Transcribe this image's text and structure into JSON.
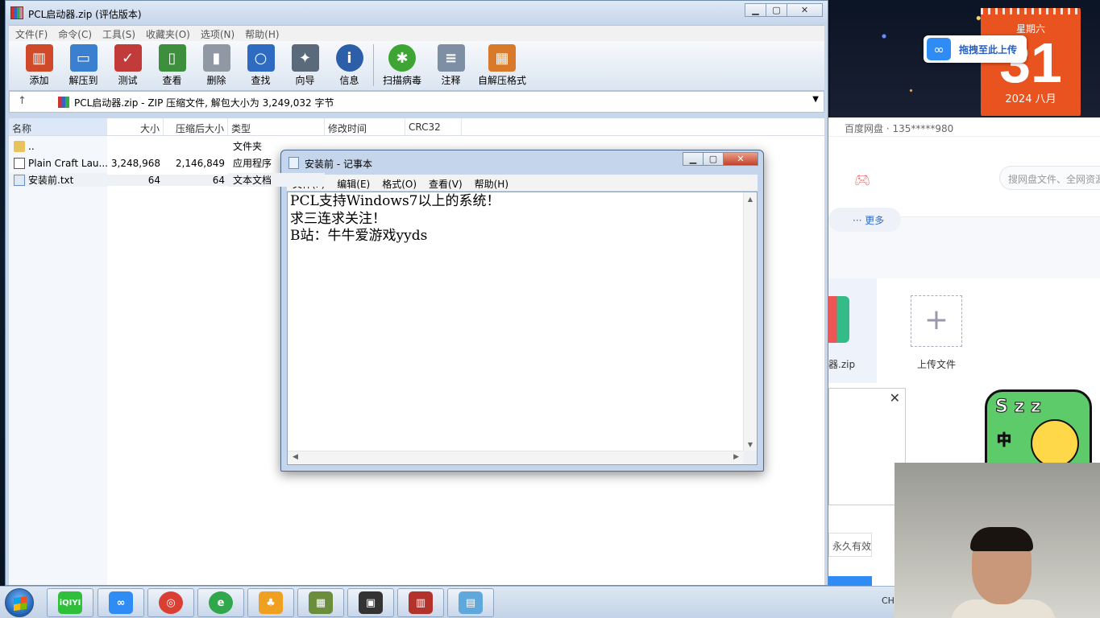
{
  "winrar": {
    "title": "PCL启动器.zip (评估版本)",
    "menu": [
      "文件(F)",
      "命令(C)",
      "工具(S)",
      "收藏夹(O)",
      "选项(N)",
      "帮助(H)"
    ],
    "toolbar": [
      {
        "label": "添加",
        "icon": "books-add-icon",
        "color": "#d04a2a"
      },
      {
        "label": "解压到",
        "icon": "folder-extract-icon",
        "color": "#3a7fd0"
      },
      {
        "label": "测试",
        "icon": "clipboard-check-icon",
        "color": "#c23b3b"
      },
      {
        "label": "查看",
        "icon": "open-book-icon",
        "color": "#3d8f3d"
      },
      {
        "label": "删除",
        "icon": "trash-icon",
        "color": "#8f98a3"
      },
      {
        "label": "查找",
        "icon": "magnifier-icon",
        "color": "#2f6bc1"
      },
      {
        "label": "向导",
        "icon": "magic-wand-icon",
        "color": "#5b6a7a"
      },
      {
        "label": "信息",
        "icon": "info-icon",
        "color": "#2d5ea8"
      },
      {
        "label": "扫描病毒",
        "icon": "virus-scan-icon",
        "color": "#3ea434"
      },
      {
        "label": "注释",
        "icon": "comment-icon",
        "color": "#7f8fa3"
      },
      {
        "label": "自解压格式",
        "icon": "sfx-box-icon",
        "color": "#d97a2a"
      }
    ],
    "path_text": "PCL启动器.zip - ZIP 压缩文件, 解包大小为 3,249,032 字节",
    "columns": [
      "名称",
      "大小",
      "压缩后大小",
      "类型",
      "修改时间",
      "CRC32"
    ],
    "files": [
      {
        "name": "..",
        "size": "",
        "packed": "",
        "type": "文件夹",
        "icon": "folder"
      },
      {
        "name": "Plain Craft Lau...",
        "size": "3,248,968",
        "packed": "2,146,849",
        "type": "应用程序",
        "icon": "app"
      },
      {
        "name": "安装前.txt",
        "size": "64",
        "packed": "64",
        "type": "文本文档",
        "icon": "txt"
      }
    ]
  },
  "notepad": {
    "title": "安装前 - 记事本",
    "menu": [
      "文件(F)",
      "编辑(E)",
      "格式(O)",
      "查看(V)",
      "帮助(H)"
    ],
    "content": "PCL支持Windows7以上的系统！\n求三连求关注！\nB站：牛牛爱游戏yyds"
  },
  "desktop": {
    "calendar": {
      "weekday": "星期六",
      "day": "31",
      "year_month": "2024 八月"
    },
    "upload_pill": "拖拽至此上传",
    "baidu": {
      "title": "百度网盘 · 135*****980",
      "search_placeholder": "搜网盘文件、全网资源",
      "more": "··· 更多",
      "file_name": "器.zip",
      "upload_label": "上传文件",
      "permanent": "永久有效"
    },
    "sticker": {
      "zz": "S z z",
      "zh": "中"
    },
    "tray_lang": "CH"
  },
  "taskbar": {
    "apps": [
      {
        "name": "iqiyi",
        "label": "iQIYI",
        "color": "#2fbf3a"
      },
      {
        "name": "baidu-netdisk",
        "label": "∞",
        "color": "#2f8cf5"
      },
      {
        "name": "chrome",
        "label": "◎",
        "color": "#d93f33"
      },
      {
        "name": "ie",
        "label": "e",
        "color": "#2fa74a"
      },
      {
        "name": "qq",
        "label": "♣",
        "color": "#f0a020"
      },
      {
        "name": "minecraft",
        "label": "▦",
        "color": "#6b8e3d"
      },
      {
        "name": "bilibili",
        "label": "▣",
        "color": "#333333"
      },
      {
        "name": "winrar",
        "label": "▥",
        "color": "#b3322c"
      },
      {
        "name": "notepad",
        "label": "▤",
        "color": "#5fa8dc"
      }
    ]
  }
}
